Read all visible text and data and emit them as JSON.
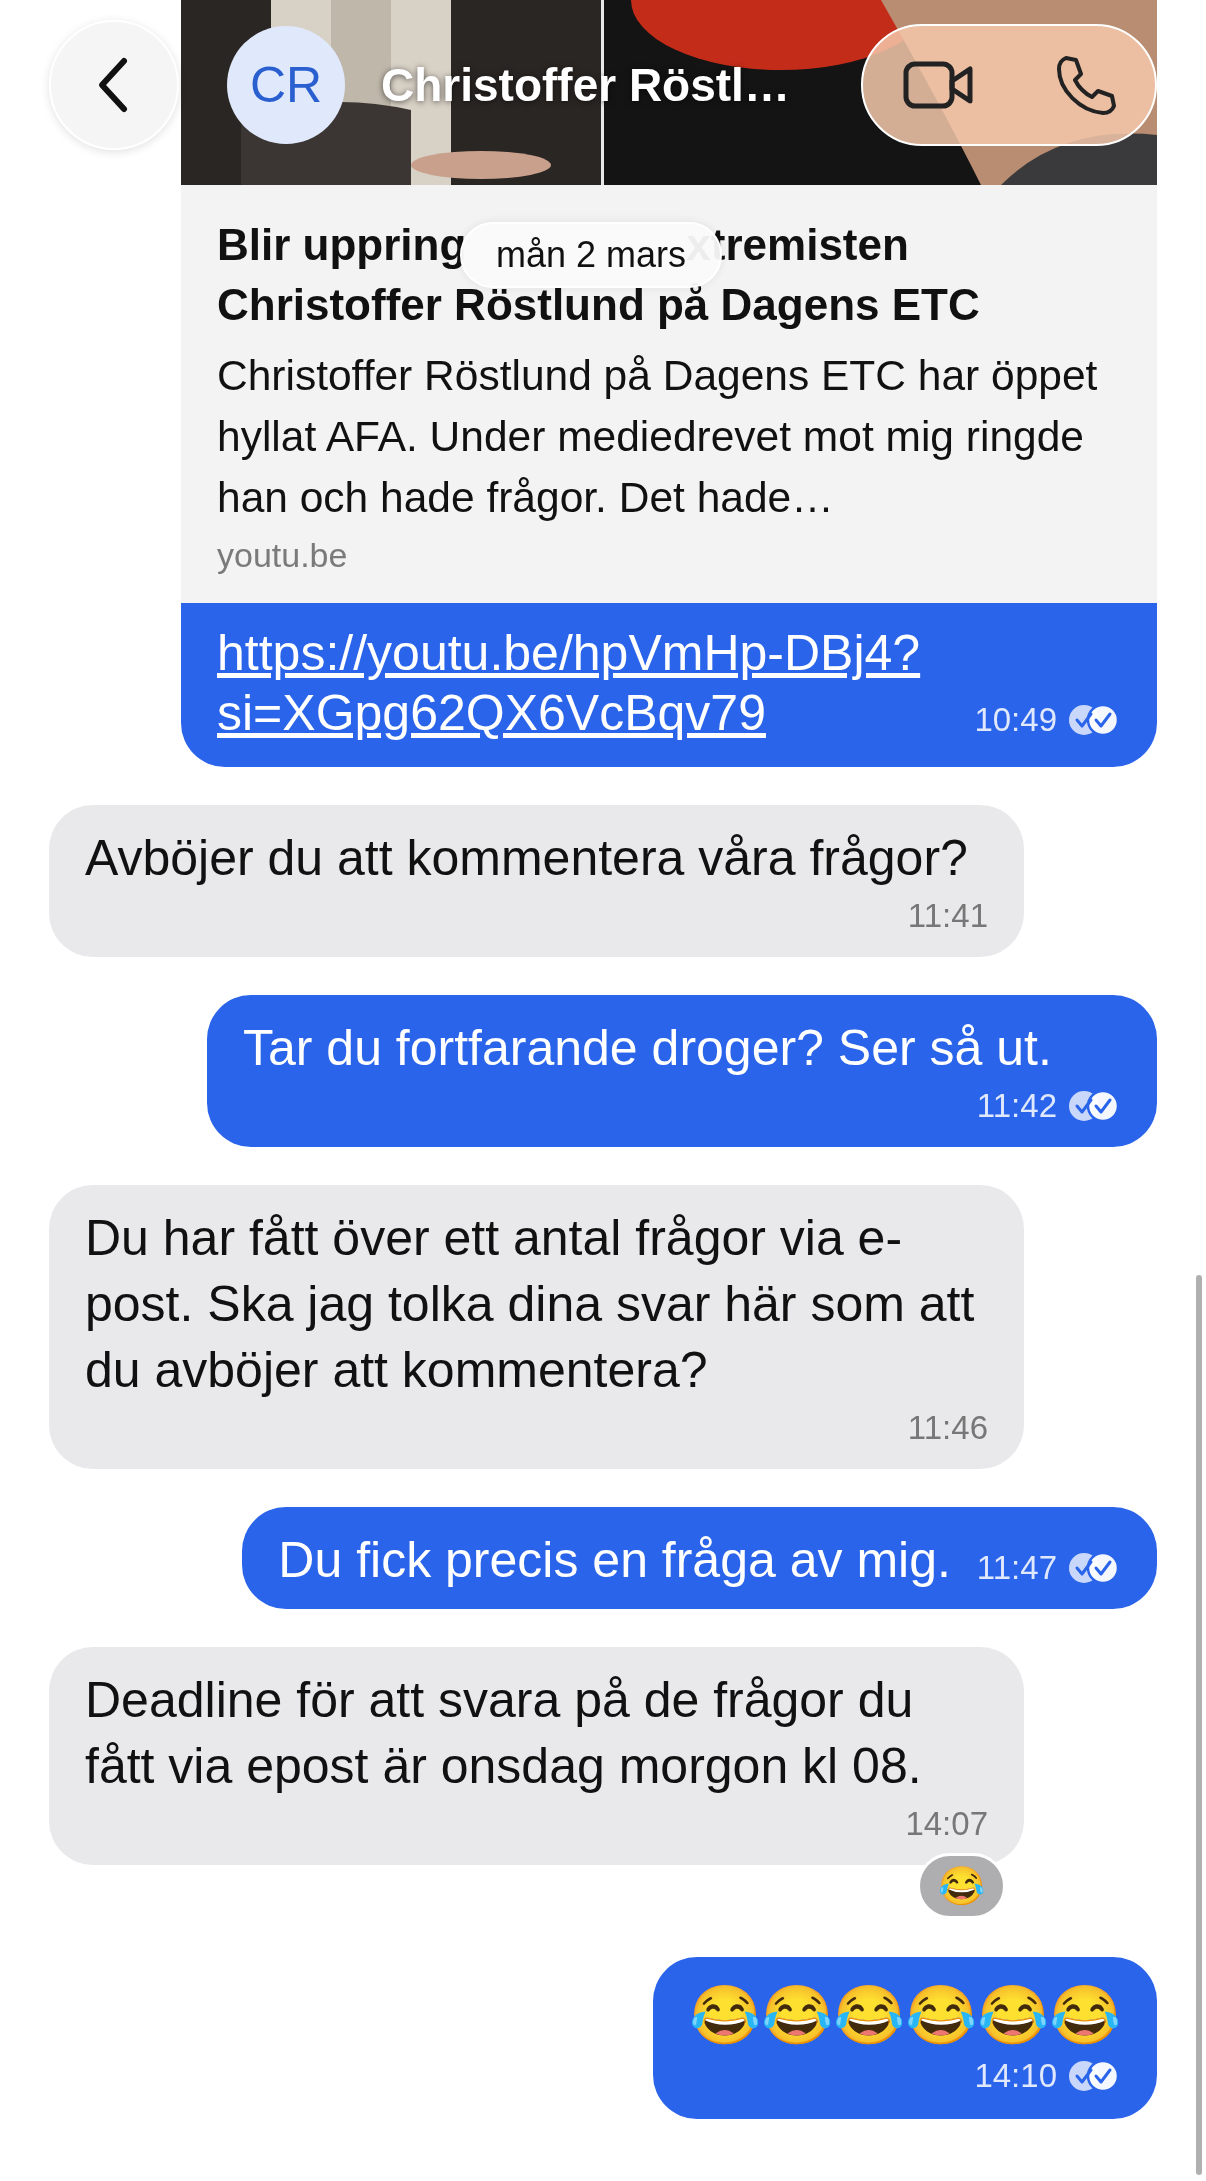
{
  "header": {
    "avatar_initials": "CR",
    "name": "Christoffer Röstl…"
  },
  "date_separator": "mån 2 mars",
  "messages": [
    {
      "kind": "link",
      "sent": true,
      "preview": {
        "title_parts": [
          "Blir uppring",
          "xtremisten",
          "Christoffer Röstlund på Dagens ETC"
        ],
        "description": "Christoffer Röstlund på Dagens ETC har öppet hyllat AFA. Under mediedrevet mot mig ringde han och hade frågor. Det hade…",
        "domain": "youtu.be"
      },
      "url": "https://youtu.be/hpVmHp-DBj4?si=XGpg62QX6VcBqv79",
      "time": "10:49",
      "read": true
    },
    {
      "kind": "text",
      "sent": false,
      "text": "Avböjer du att kommentera våra frågor?",
      "time": "11:41"
    },
    {
      "kind": "text",
      "sent": true,
      "text": "Tar du fortfarande droger? Ser så ut.",
      "time": "11:42",
      "read": true
    },
    {
      "kind": "text",
      "sent": false,
      "text": "Du har fått över ett antal frågor via e-post. Ska jag tolka dina svar här som att du avböjer att kommentera?",
      "time": "11:46"
    },
    {
      "kind": "text",
      "sent": true,
      "text": "Du fick precis en fråga av mig.",
      "time": "11:47",
      "read": true
    },
    {
      "kind": "text",
      "sent": false,
      "text": "Deadline för att svara på de frågor du fått via epost är onsdag morgon kl 08.",
      "time": "14:07",
      "reaction": "😂"
    },
    {
      "kind": "emoji",
      "sent": true,
      "text": "😂😂😂😂😂😂",
      "time": "14:10",
      "read": true
    }
  ]
}
